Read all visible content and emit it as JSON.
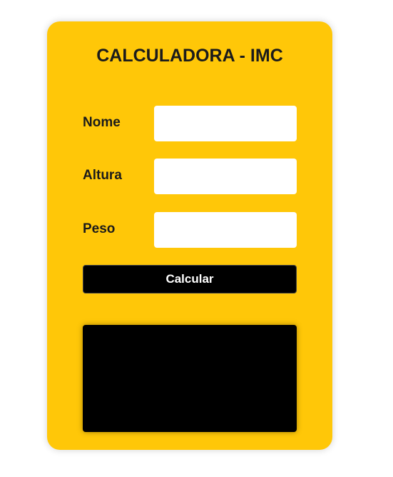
{
  "card": {
    "title": "CALCULADORA - IMC",
    "background_color": "#ffc708"
  },
  "form": {
    "fields": [
      {
        "label": "Nome",
        "value": "",
        "placeholder": ""
      },
      {
        "label": "Altura",
        "value": "",
        "placeholder": ""
      },
      {
        "label": "Peso",
        "value": "",
        "placeholder": ""
      }
    ],
    "calculate_label": "Calcular"
  },
  "result": {
    "text": ""
  }
}
